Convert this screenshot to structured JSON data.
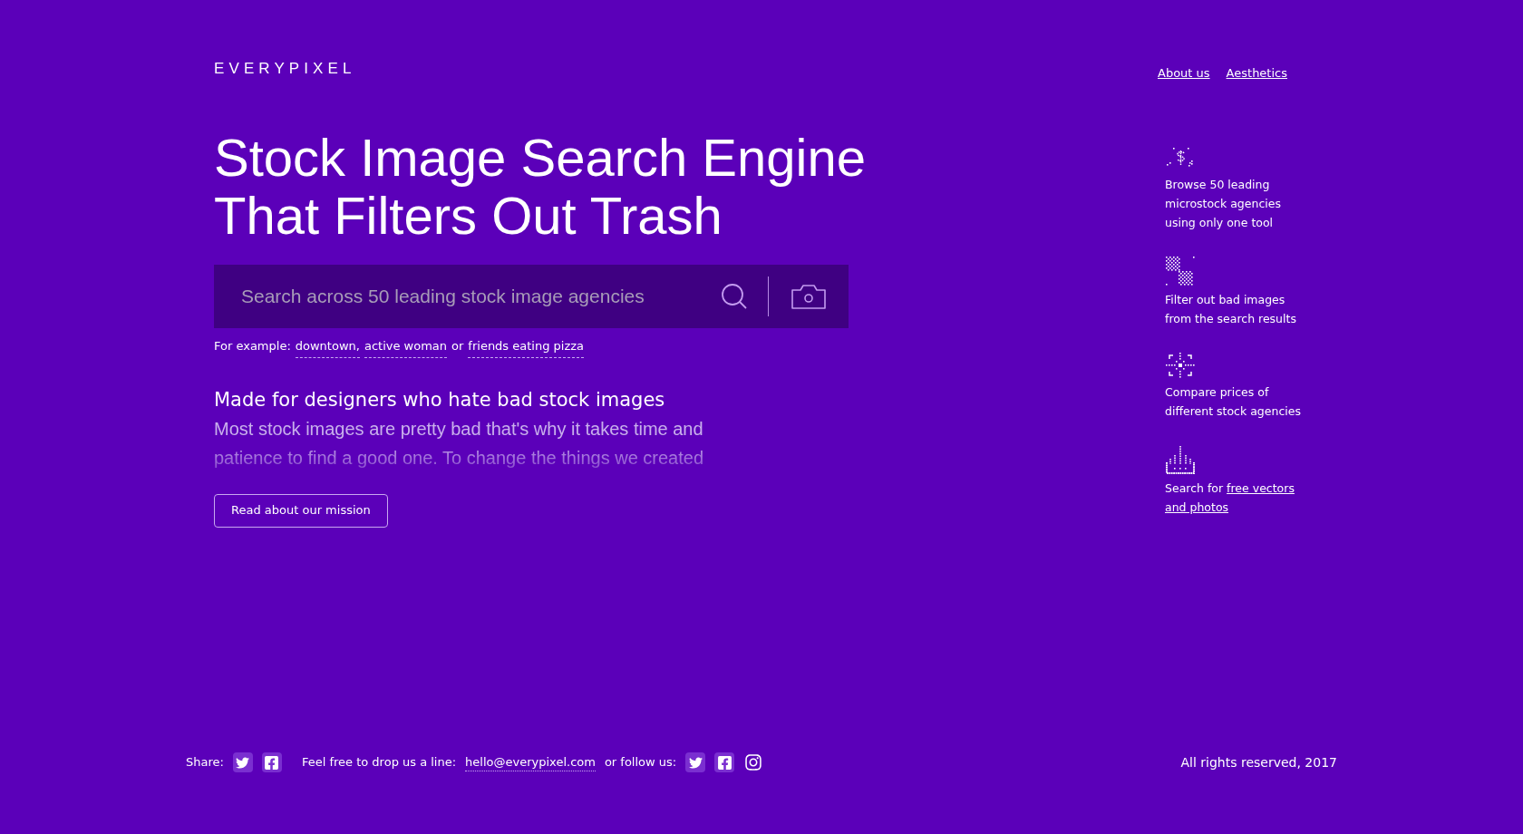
{
  "logo": "EVERYPIXEL",
  "nav": [
    {
      "label": "About us"
    },
    {
      "label": "Aesthetics"
    }
  ],
  "hero": {
    "title_lines": [
      "Stock Image Search Engine",
      "That Filters Out Trash"
    ],
    "search": {
      "placeholder": "Search across 50 leading stock image agencies"
    },
    "examples": {
      "prefix": "For example:",
      "links": [
        "downtown,",
        "active woman"
      ],
      "joiner": "or",
      "last": "friends eating pizza"
    },
    "heading": "Made for designers who hate bad stock images",
    "paragraph": "Most stock images are pretty bad that's why it takes time and patience to find a good one. To change the things we created",
    "button": "Read about our mission"
  },
  "features": [
    {
      "kind": "price",
      "lines": [
        "Browse 50 leading",
        "microstock agencies",
        "using only one tool"
      ]
    },
    {
      "kind": "filter",
      "lines": [
        "Filter out bad images",
        "from the search results"
      ]
    },
    {
      "kind": "compare",
      "lines": [
        "Compare prices of",
        "different stock agencies"
      ]
    },
    {
      "kind": "free",
      "text": "Search for",
      "link_lines": [
        "free vectors",
        "and photos"
      ]
    }
  ],
  "footer": {
    "share_label": "Share:",
    "share_icons": [
      {
        "kind": "twitter"
      },
      {
        "kind": "facebook"
      }
    ],
    "contact_text": "Feel free to drop us a line:",
    "email": "hello@everypixel.com",
    "follow_text": "or follow us:",
    "follow_icons": [
      {
        "kind": "twitter"
      },
      {
        "kind": "facebook"
      },
      {
        "kind": "instagram"
      }
    ],
    "rights": "All rights reserved, 2017"
  }
}
